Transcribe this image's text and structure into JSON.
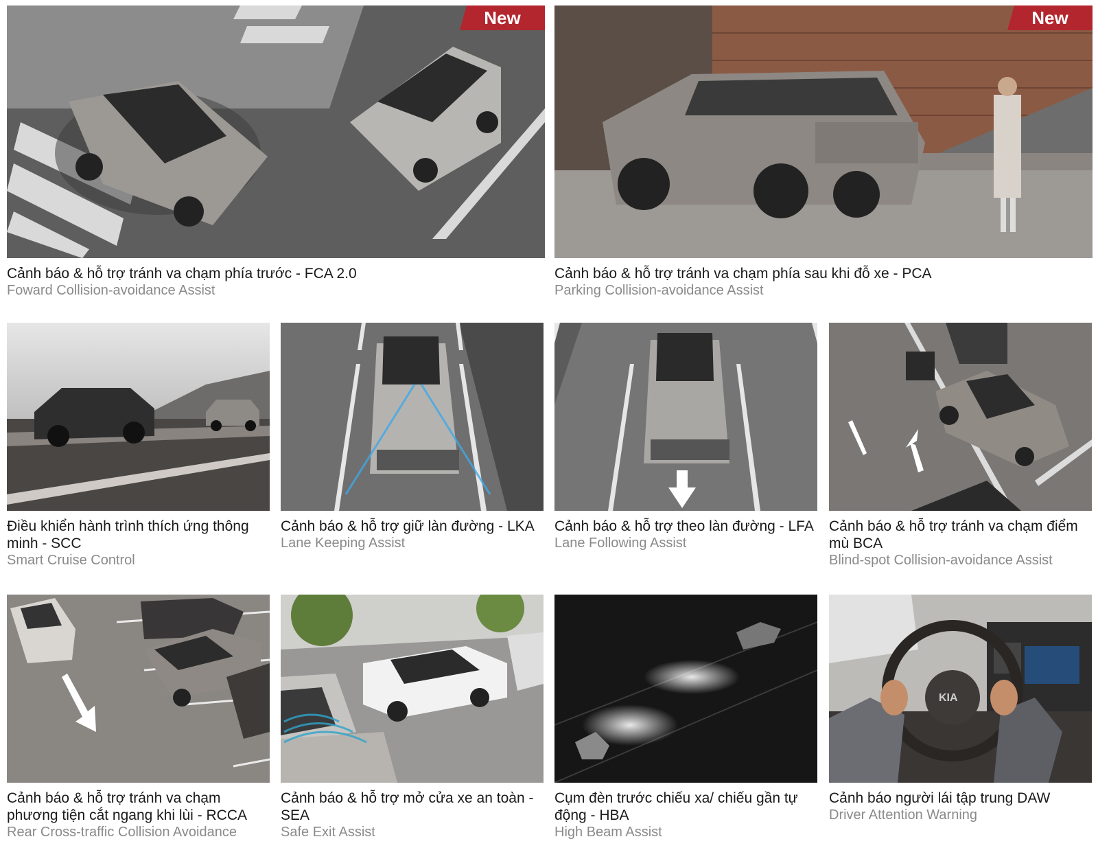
{
  "badge_label": "New",
  "cards": [
    {
      "title": "Cảnh báo & hỗ trợ tránh va chạm phía trước - FCA 2.0",
      "subtitle": "Foward Collision-avoidance Assist",
      "badge": true
    },
    {
      "title": "Cảnh báo & hỗ trợ tránh va chạm phía sau khi đỗ xe - PCA",
      "subtitle": "Parking Collision-avoidance Assist",
      "badge": true
    },
    {
      "title": "Điều khiển hành trình thích ứng thông minh - SCC",
      "subtitle": "Smart Cruise Control",
      "badge": false
    },
    {
      "title": "Cảnh báo & hỗ trợ giữ làn đường - LKA",
      "subtitle": "Lane Keeping Assist",
      "badge": false
    },
    {
      "title": "Cảnh báo & hỗ trợ theo làn đường - LFA",
      "subtitle": "Lane Following Assist",
      "badge": false
    },
    {
      "title": "Cảnh báo & hỗ trợ tránh va chạm điểm mù BCA",
      "subtitle": "Blind-spot Collision-avoidance Assist",
      "badge": false
    },
    {
      "title": "Cảnh báo & hỗ trợ tránh va chạm phương tiện cắt ngang khi lùi - RCCA",
      "subtitle": "Rear Cross-traffic Collision Avoidance",
      "badge": false
    },
    {
      "title": "Cảnh báo & hỗ trợ mở cửa xe an toàn - SEA",
      "subtitle": "Safe Exit Assist",
      "badge": false
    },
    {
      "title": "Cụm đèn trước chiếu xa/ chiếu gần tự động - HBA",
      "subtitle": "High Beam Assist",
      "badge": false
    },
    {
      "title": "Cảnh báo người lái tập trung DAW",
      "subtitle": "Driver Attention Warning",
      "badge": false
    }
  ],
  "colors": {
    "badge": "#b3262e",
    "title": "#1a1a1a",
    "subtitle": "#8a8a8a"
  }
}
